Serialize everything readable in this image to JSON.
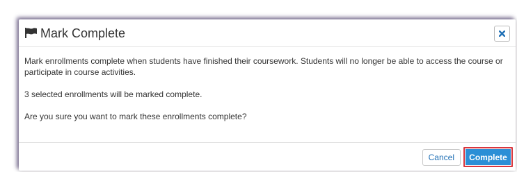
{
  "dialog": {
    "title": "Mark Complete",
    "title_icon": "flag-icon",
    "close_icon": "close-icon",
    "body": {
      "paragraph_1": "Mark enrollments complete when students have finished their coursework. Students will no longer be able to access the course or participate in course activities.",
      "paragraph_2": "3 selected enrollments will be marked complete.",
      "paragraph_3": "Are you sure you want to mark these enrollments complete?"
    },
    "footer": {
      "cancel_label": "Cancel",
      "complete_label": "Complete"
    }
  },
  "colors": {
    "primary_button": "#2b8fd6",
    "highlight_border": "#d9363e",
    "close_icon": "#1f6fb5",
    "text": "#333333"
  }
}
